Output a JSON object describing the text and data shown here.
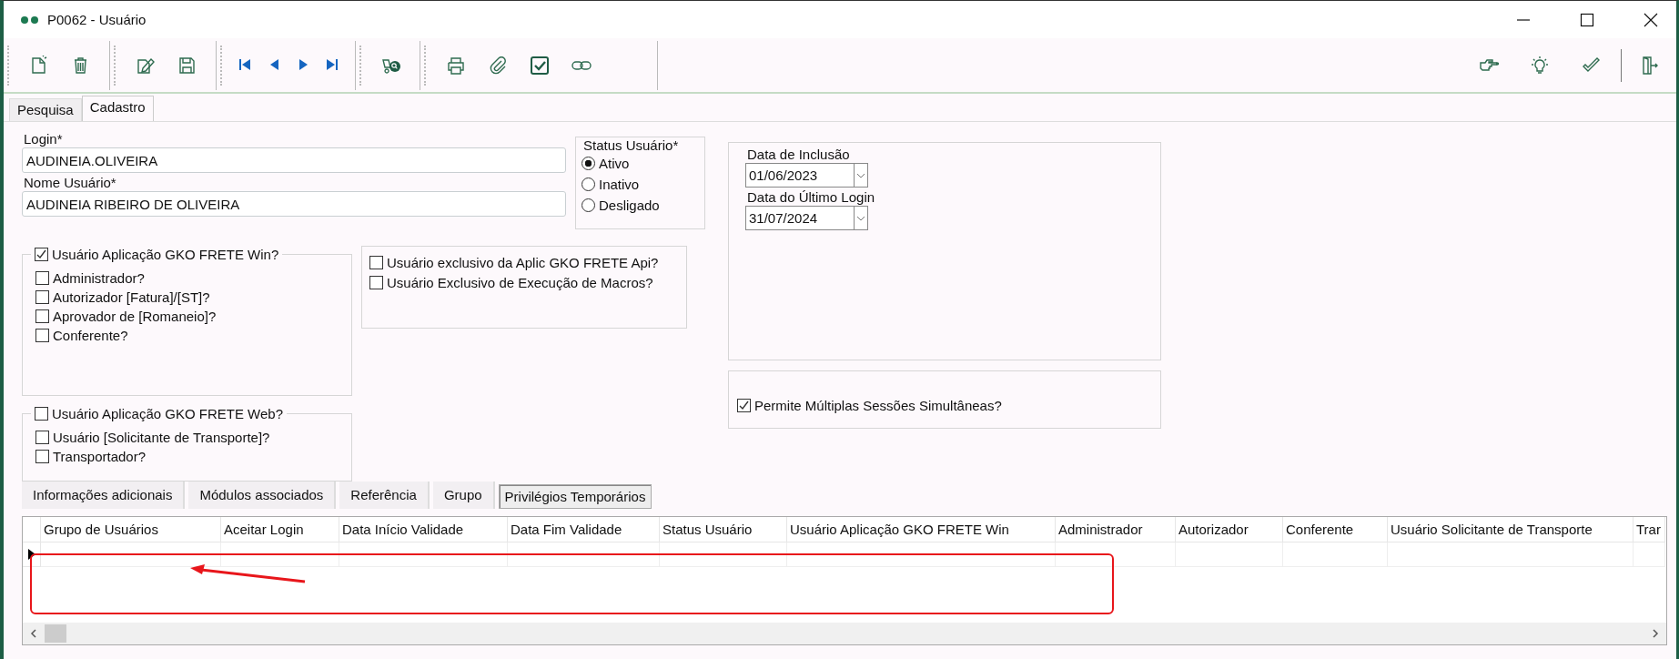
{
  "window": {
    "title": "P0062 - Usuário"
  },
  "main_tabs": [
    {
      "label": "Pesquisa",
      "selected": false
    },
    {
      "label": "Cadastro",
      "selected": true
    }
  ],
  "form": {
    "login": {
      "label": "Login*",
      "value": "AUDINEIA.OLIVEIRA"
    },
    "name": {
      "label": "Nome Usuário*",
      "value": "AUDINEIA RIBEIRO DE OLIVEIRA"
    },
    "status": {
      "label": "Status Usuário*",
      "options": [
        {
          "label": "Ativo",
          "selected": true
        },
        {
          "label": "Inativo",
          "selected": false
        },
        {
          "label": "Desligado",
          "selected": false
        }
      ]
    },
    "win_group": {
      "label": "Usuário Aplicação GKO FRETE Win?",
      "checked": true,
      "options": [
        {
          "label": "Administrador?",
          "checked": false
        },
        {
          "label": "Autorizador [Fatura]/[ST]?",
          "checked": false
        },
        {
          "label": "Aprovador de [Romaneio]?",
          "checked": false
        },
        {
          "label": "Conferente?",
          "checked": false
        }
      ]
    },
    "web_group": {
      "label": "Usuário Aplicação GKO FRETE Web?",
      "checked": false,
      "options": [
        {
          "label": "Usuário [Solicitante de Transporte]?",
          "checked": false
        },
        {
          "label": "Transportador?",
          "checked": false
        }
      ]
    },
    "api_options": [
      {
        "label": "Usuário exclusivo da Aplic GKO FRETE Api?",
        "checked": false
      },
      {
        "label": "Usuário Exclusivo de Execução de Macros?",
        "checked": false
      }
    ],
    "dates": [
      {
        "label": "Data de Inclusão",
        "value": "01/06/2023"
      },
      {
        "label": "Data do Último Login",
        "value": "31/07/2024"
      }
    ],
    "multi_session": {
      "label": "Permite Múltiplas Sessões Simultâneas?",
      "checked": true
    }
  },
  "detail_tabs": [
    {
      "label": "Informações adicionais",
      "selected": false
    },
    {
      "label": "Módulos associados",
      "selected": false
    },
    {
      "label": "Referência",
      "selected": false
    },
    {
      "label": "Grupo",
      "selected": false
    },
    {
      "label": "Privilégios Temporários",
      "selected": true
    }
  ],
  "grid": {
    "columns": [
      "Grupo de Usuários",
      "Aceitar Login",
      "Data Início Validade",
      "Data Fim Validade",
      "Status Usuário",
      "Usuário Aplicação GKO FRETE Win",
      "Administrador",
      "Autorizador",
      "Conferente",
      "Usuário Solicitante de Transporte",
      "Trar"
    ],
    "rows": [
      {
        "current": true
      }
    ]
  }
}
